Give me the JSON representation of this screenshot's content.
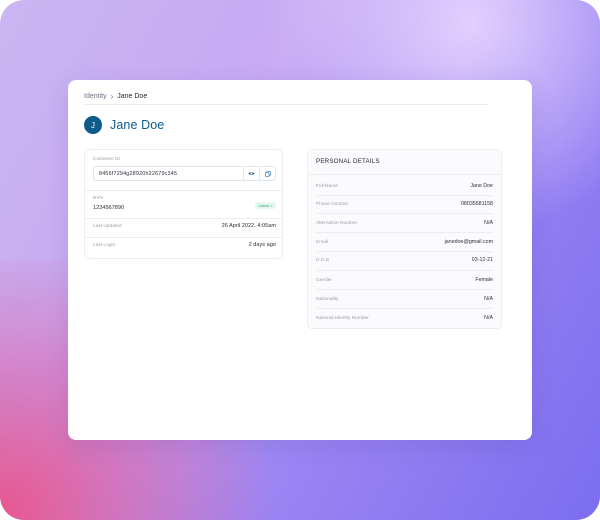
{
  "breadcrumb": {
    "root": "Identity",
    "current": "Jane Doe"
  },
  "profile": {
    "avatar_initial": "J",
    "name": "Jane Doe"
  },
  "summary": {
    "customer_id_label": "Customer ID",
    "customer_id_value": "8456f7294g28920h22679c345",
    "bvn_label": "BVN",
    "bvn_value": "1234567890",
    "bvn_badge": "Linked",
    "last_updated_label": "Last Updated",
    "last_updated_value": "26 April 2022, 4:05am",
    "last_login_label": "Last Login",
    "last_login_value": "2 days ago"
  },
  "personal": {
    "title": "PERSONAL DETAILS",
    "rows": [
      {
        "label": "Full Name",
        "value": "Jane Doe"
      },
      {
        "label": "Phone Number",
        "value": "08035681158"
      },
      {
        "label": "Alternative Number",
        "value": "N/A"
      },
      {
        "label": "Email",
        "value": "janedoe@gmail.com"
      },
      {
        "label": "D.O.B",
        "value": "03-12-21"
      },
      {
        "label": "Gender",
        "value": "Female"
      },
      {
        "label": "Nationality",
        "value": "N/A"
      },
      {
        "label": "National Identity Number",
        "value": "N/A"
      }
    ]
  },
  "colors": {
    "accent": "#0b5c8a",
    "badge_bg": "#e6f8ef",
    "badge_text": "#23a36a"
  },
  "icons": {
    "breadcrumb_separator": "chevron-right-icon",
    "reveal": "eye-icon",
    "copy": "copy-icon",
    "badge": "check-icon"
  }
}
